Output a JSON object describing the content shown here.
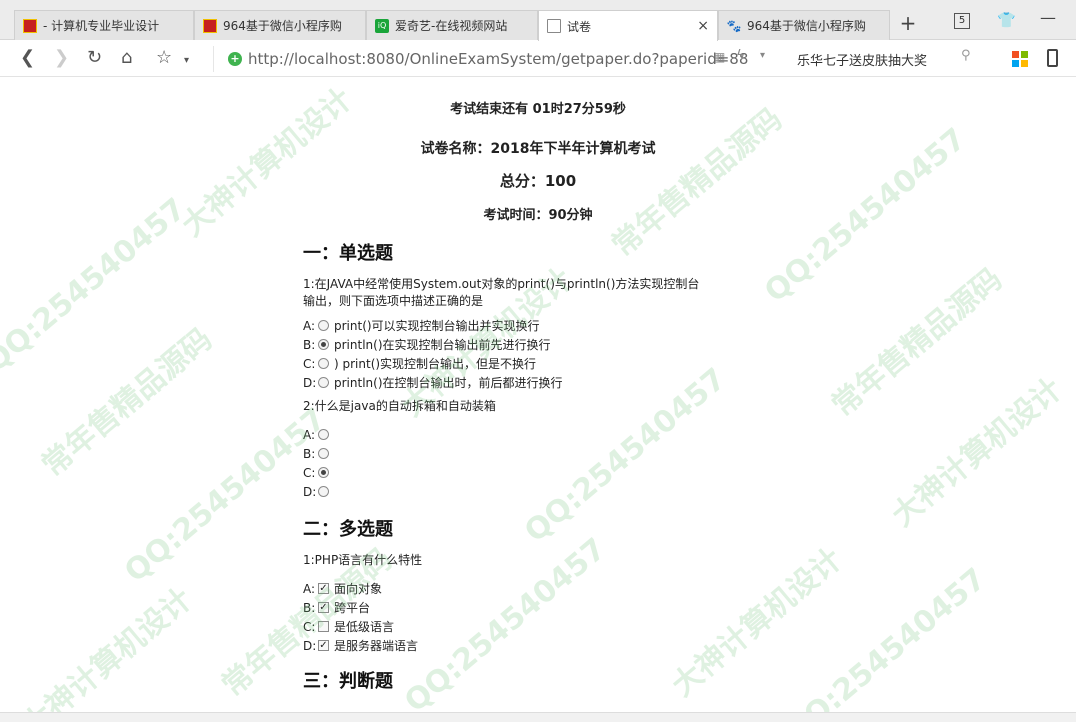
{
  "tabs": [
    {
      "label": "- 计算机专业毕业设计",
      "icon": "red-square-icon"
    },
    {
      "label": "964基于微信小程序购",
      "icon": "red-square-icon"
    },
    {
      "label": "爱奇艺-在线视频网站",
      "icon": "iqiyi-icon"
    },
    {
      "label": "试卷",
      "icon": "document-icon",
      "close": "×"
    },
    {
      "label": "964基于微信小程序购",
      "icon": "paw-icon"
    }
  ],
  "window": {
    "tab_count": "5",
    "new_tab": "+"
  },
  "address": {
    "url": "http://localhost:8080/OnlineExamSystem/getpaper.do?paperid=88",
    "promo_text": "乐华七子送皮肤抽大奖"
  },
  "exam": {
    "countdown": "考试结束还有 01时27分59秒",
    "paper_name": "试卷名称：2018年下半年计算机考试",
    "total_score": "总分：100",
    "duration": "考试时间：90分钟"
  },
  "sections": {
    "single": {
      "title": "一：单选题",
      "q1": {
        "text": "1:在JAVA中经常使用System.out对象的print()与println()方法实现控制台输出，则下面选项中描述正确的是",
        "options": [
          {
            "key": "A:",
            "text": " print()可以实现控制台输出并实现换行",
            "checked": false
          },
          {
            "key": "B:",
            "text": "println()在实现控制台输出前先进行换行",
            "checked": true
          },
          {
            "key": "C:",
            "text": ") print()实现控制台输出，但是不换行",
            "checked": false
          },
          {
            "key": "D:",
            "text": "println()在控制台输出时，前后都进行换行",
            "checked": false
          }
        ]
      },
      "q2": {
        "text": "2:什么是java的自动拆箱和自动装箱",
        "options": [
          {
            "key": "A:",
            "text": "",
            "checked": false
          },
          {
            "key": "B:",
            "text": "",
            "checked": false
          },
          {
            "key": "C:",
            "text": "",
            "checked": true
          },
          {
            "key": "D:",
            "text": "",
            "checked": false
          }
        ]
      }
    },
    "multiple": {
      "title": "二：多选题",
      "q1": {
        "text": "1:PHP语言有什么特性",
        "options": [
          {
            "key": "A:",
            "text": "面向对象",
            "checked": true
          },
          {
            "key": "B:",
            "text": "跨平台",
            "checked": true
          },
          {
            "key": "C:",
            "text": "是低级语言",
            "checked": false
          },
          {
            "key": "D:",
            "text": "是服务器端语言",
            "checked": true
          }
        ]
      }
    },
    "judge": {
      "title": "三：判断题"
    }
  },
  "watermark": {
    "brand": "大神计算机设计",
    "qq": "QQ:254540457",
    "slogan": "常年售精品源码"
  },
  "colors": {
    "accent_green": "#3fb34f",
    "watermark": "#6ebe78",
    "tab_active": "#ffffff"
  }
}
